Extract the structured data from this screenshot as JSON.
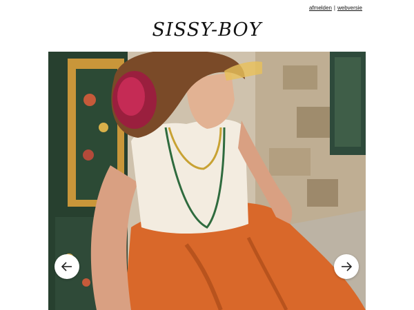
{
  "header": {
    "links": [
      "afmelden",
      "webversie"
    ],
    "separator": "|",
    "brand": "SISSY-BOY"
  },
  "hero": {
    "image_subject": "woman-in-orange-skirt",
    "prev_icon": "arrow-left-icon",
    "next_icon": "arrow-right-icon"
  }
}
